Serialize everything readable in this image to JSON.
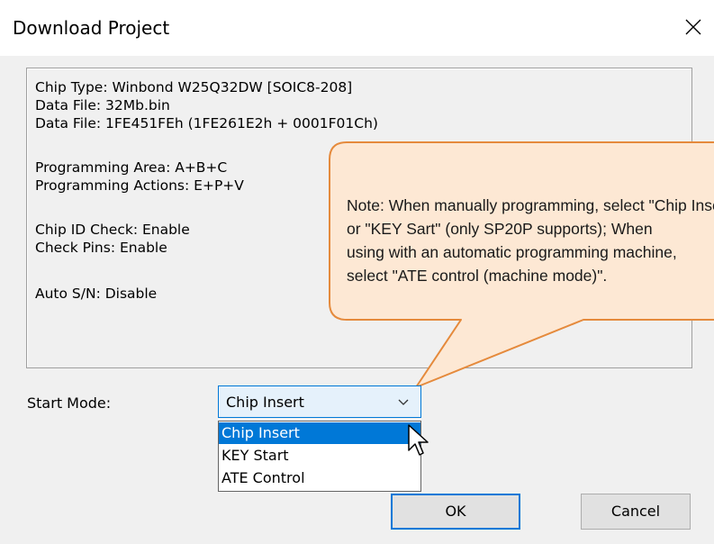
{
  "window": {
    "title": "Download Project",
    "close_icon": "close-icon"
  },
  "info": {
    "chip_type": "Chip Type: Winbond  W25Q32DW  [SOIC8-208]",
    "data_file_name": "Data File: 32Mb.bin",
    "data_file_checksum": "Data File: 1FE451FEh (1FE261E2h + 0001F01Ch)",
    "programming_area": "Programming Area: A+B+C",
    "programming_actions": "Programming Actions: E+P+V",
    "chip_id_check": "Chip ID Check: Enable",
    "check_pins": "Check Pins: Enable",
    "auto_sn": "Auto S/N: Disable"
  },
  "callout": {
    "line1": "Note: When manually programming, select \"Chip Insert\"",
    "line2": "or \"KEY Sart\" (only SP20P supports);  When",
    "line3": "using with an automatic programming machine,",
    "line4": "select \"ATE control (machine mode)\".",
    "fill_color": "#fde8d4",
    "border_color": "#e58a3c"
  },
  "start_mode": {
    "label": "Start Mode:",
    "selected": "Chip Insert",
    "options": [
      "Chip Insert",
      "KEY Start",
      "ATE Control"
    ],
    "highlighted_index": 0
  },
  "buttons": {
    "ok": "OK",
    "cancel": "Cancel"
  },
  "colors": {
    "accent": "#0078d7",
    "dialog_bg": "#f0f0f0"
  }
}
